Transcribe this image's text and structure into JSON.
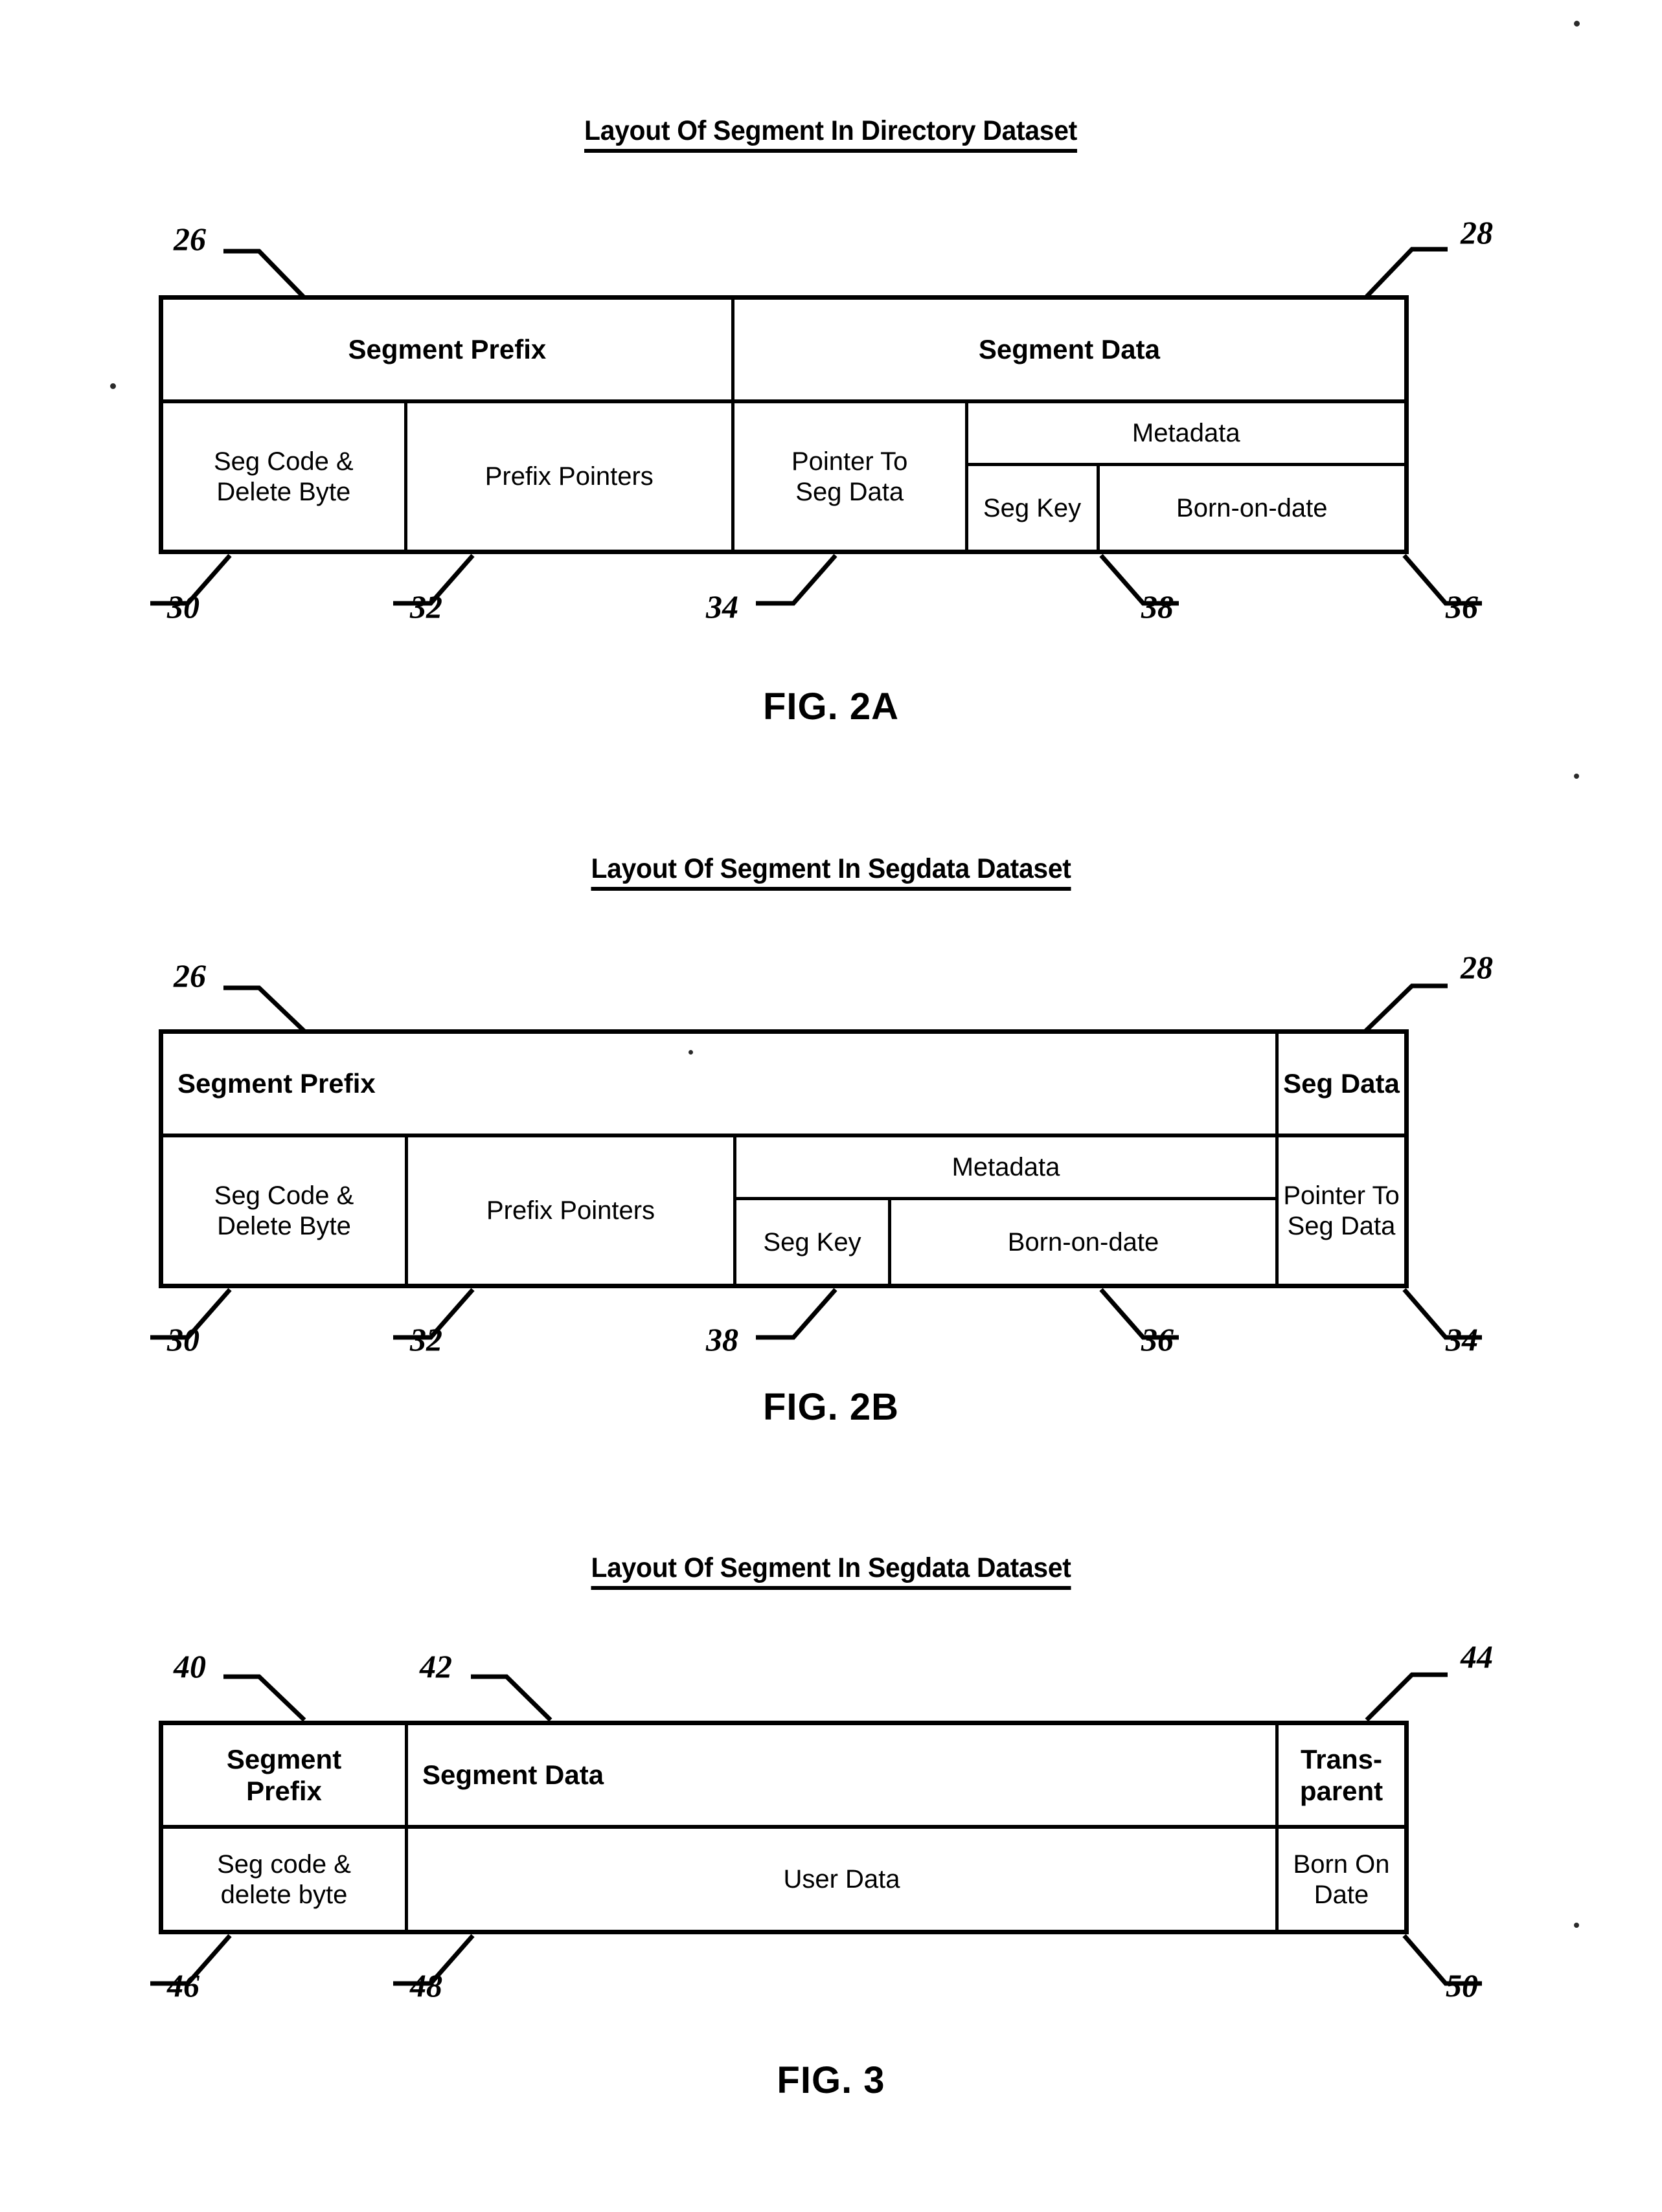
{
  "figures": [
    {
      "heading": "Layout Of Segment In Directory Dataset",
      "caption": "FIG. 2A",
      "header_row": [
        {
          "label": "Segment Prefix"
        },
        {
          "label": "Segment Data"
        }
      ],
      "data_row": [
        {
          "label": "Seg Code &\nDelete Byte"
        },
        {
          "label": "Prefix Pointers"
        },
        {
          "label": "Pointer To\nSeg Data"
        },
        {
          "label": "Metadata"
        },
        {
          "label": "Seg Key"
        },
        {
          "label": "Born-on-date"
        }
      ],
      "refs_top": [
        "26",
        "28"
      ],
      "refs_bottom": [
        "30",
        "32",
        "34",
        "38",
        "36"
      ]
    },
    {
      "heading": "Layout Of Segment In Segdata Dataset",
      "caption": "FIG. 2B",
      "header_row": [
        {
          "label": "Segment Prefix"
        },
        {
          "label": "Seg Data"
        }
      ],
      "data_row": [
        {
          "label": "Seg Code &\nDelete Byte"
        },
        {
          "label": "Prefix Pointers"
        },
        {
          "label": "Metadata"
        },
        {
          "label": "Seg Key"
        },
        {
          "label": "Born-on-date"
        },
        {
          "label": "Pointer To\nSeg Data"
        }
      ],
      "refs_top": [
        "26",
        "28"
      ],
      "refs_bottom": [
        "30",
        "32",
        "38",
        "36",
        "34"
      ]
    },
    {
      "heading": "Layout Of Segment In Segdata Dataset",
      "caption": "FIG. 3",
      "header_row": [
        {
          "label": "Segment\nPrefix"
        },
        {
          "label": "Segment Data"
        },
        {
          "label": "Trans-\nparent"
        }
      ],
      "data_row": [
        {
          "label": "Seg code &\ndelete byte"
        },
        {
          "label": "User Data"
        },
        {
          "label": "Born On\nDate"
        }
      ],
      "refs_top": [
        "40",
        "42",
        "44"
      ],
      "refs_bottom": [
        "46",
        "48",
        "50"
      ]
    }
  ],
  "labels": {
    "segment_prefix": "Segment Prefix",
    "segment_data": "Segment Data",
    "seg_data": "Seg Data",
    "seg_code_delete_byte": "Seg Code &\nDelete Byte",
    "seg_code_delete_byte_lc": "Seg code &\ndelete byte",
    "prefix_pointers": "Prefix Pointers",
    "pointer_to_seg_data": "Pointer To\nSeg Data",
    "metadata": "Metadata",
    "seg_key": "Seg Key",
    "born_on_date": "Born-on-date",
    "segment_prefix_2line": "Segment\nPrefix",
    "transparent": "Trans-\nparent",
    "user_data": "User Data",
    "born_on_date_2line": "Born On\nDate"
  },
  "colors": {
    "ink": "#000000",
    "paper": "#ffffff"
  }
}
